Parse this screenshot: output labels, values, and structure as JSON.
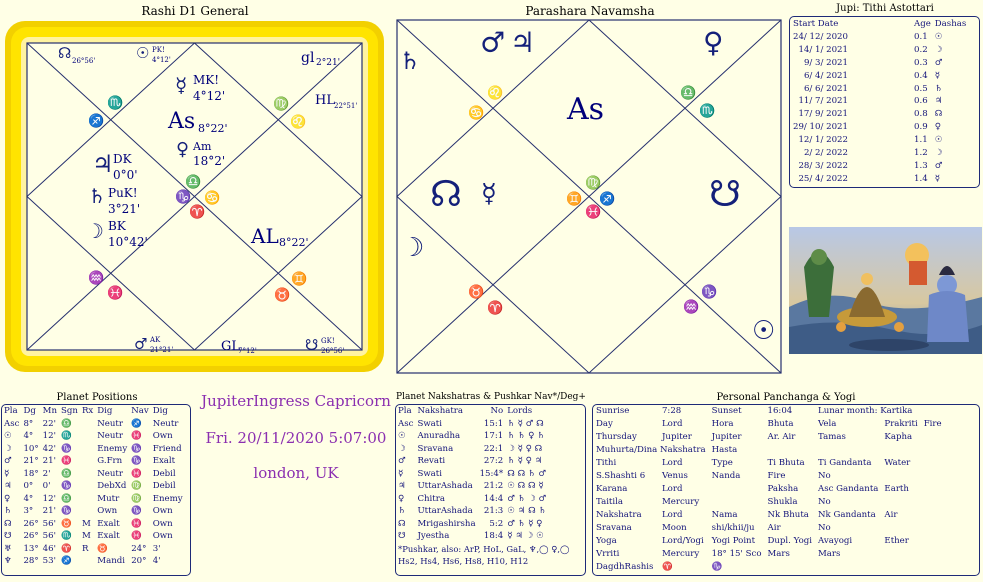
{
  "rashi": {
    "title": "Rashi D1 General",
    "signs": {
      "h1": "♎",
      "h2": "♏",
      "h3": "♐",
      "h4": "♑",
      "h5": "♒",
      "h6": "♓",
      "h7": "♈",
      "h8": "♉",
      "h9": "♊",
      "h10": "♋",
      "h11": "♌",
      "h12": "♍"
    },
    "asc_label": "As",
    "asc_deg": "8°22'",
    "mercury_tag": "MK!",
    "mercury_deg": "4°12'",
    "venus_tag": "Am",
    "venus_deg": "18°2'",
    "jupiter_tag": "DK",
    "jupiter_deg": "0°0'",
    "saturn_tag": "PuK!",
    "saturn_deg": "3°21'",
    "moon_tag": "BK",
    "moon_deg": "10°42'",
    "mars_tag": "AK",
    "mars_deg": "21°21'",
    "ketu_tag": "GK!",
    "ketu_deg": "26°56'",
    "rahu_deg": "26°56'",
    "sun_tag": "PK!",
    "sun_deg": "4°12'",
    "gl_top_label": "gl",
    "gl_top_deg": "2°21'",
    "hl_label": "HL",
    "hl_deg": "22°51'",
    "al_label": "AL",
    "al_deg": "8°22'",
    "gl_bottom_label": "GL",
    "gl_bottom_deg": "7°12'"
  },
  "navamsa": {
    "title": "Parashara Navamsha",
    "asc_label": "As",
    "signs": {
      "h1": "♍",
      "h2": "♌",
      "h3": "♋",
      "h4": "♊",
      "h5": "♉",
      "h6": "♈",
      "h7": "♓",
      "h8": "♒",
      "h9": "♑",
      "h10": "♐",
      "h11": "♏",
      "h12": "♎"
    }
  },
  "center": {
    "event": "JupiterIngress Capricorn",
    "date": "Fri. 20/11/2020  5:07:00",
    "place": "london, UK"
  },
  "tithi": {
    "title": "Jupi: Tithi Astottari",
    "headers": [
      "Start Date",
      "Age",
      "Dashas"
    ],
    "rows": [
      [
        "24/ 12/ 2020",
        "0.1",
        "☉"
      ],
      [
        "14/ 1/ 2021",
        "0.2",
        "☽"
      ],
      [
        "9/ 3/ 2021",
        "0.3",
        "♂"
      ],
      [
        "6/ 4/ 2021",
        "0.4",
        "☿"
      ],
      [
        "6/ 6/ 2021",
        "0.5",
        "♄"
      ],
      [
        "11/ 7/ 2021",
        "0.6",
        "♃"
      ],
      [
        "17/ 9/ 2021",
        "0.8",
        "☊"
      ],
      [
        "29/ 10/ 2021",
        "0.9",
        "♀"
      ],
      [
        "12/ 1/ 2022",
        "1.1",
        "☉"
      ],
      [
        "2/ 2/ 2022",
        "1.2",
        "☽"
      ],
      [
        "28/ 3/ 2022",
        "1.3",
        "♂"
      ],
      [
        "25/ 4/ 2022",
        "1.4",
        "☿"
      ]
    ]
  },
  "planets": {
    "title": "Planet Positions",
    "headers": [
      "Pla",
      "Dg",
      "Mn",
      "Sgn",
      "Rx",
      "Dig",
      "Nav",
      "Dig"
    ],
    "rows": [
      [
        "Asc",
        "8°",
        "22'",
        "♎",
        "",
        "Neutr",
        "♐",
        "Neutr"
      ],
      [
        "☉",
        "4°",
        "12'",
        "♏",
        "",
        "Neutr",
        "♓",
        "Own"
      ],
      [
        "☽",
        "10°",
        "42'",
        "♑",
        "",
        "Enemy",
        "♑",
        "Friend"
      ],
      [
        "♂",
        "21°",
        "21'",
        "♓",
        "",
        "G.Frn",
        "♑",
        "Exalt"
      ],
      [
        "☿",
        "18°",
        "2'",
        "♎",
        "",
        "Neutr",
        "♓",
        "Debil"
      ],
      [
        "♃",
        "0°",
        "0'",
        "♑",
        "",
        "DebXd",
        "♍",
        "Debil"
      ],
      [
        "♀",
        "4°",
        "12'",
        "♎",
        "",
        "Mutr",
        "♍",
        "Enemy"
      ],
      [
        "♄",
        "3°",
        "21'",
        "♑",
        "",
        "Own",
        "♑",
        "Own"
      ],
      [
        "☊",
        "26°",
        "56'",
        "♉",
        "M",
        "Exalt",
        "♓",
        "Own"
      ],
      [
        "☋",
        "26°",
        "56'",
        "♏",
        "M",
        "Exalt",
        "♓",
        "Own"
      ],
      [
        "♅",
        "13°",
        "46'",
        "♈",
        "R",
        "♉",
        "24°",
        "3'"
      ],
      [
        "♆",
        "28°",
        "53'",
        "♐",
        "",
        "Mandi",
        "20°",
        "4'"
      ]
    ],
    "last_row_tail": [
      "♏",
      "♍"
    ]
  },
  "nakshatras": {
    "title": "Planet Nakshatras & Pushkar Nav*/Deg+",
    "headers": [
      "Pla",
      "Nakshatra",
      "No",
      "Lords"
    ],
    "rows": [
      [
        "Asc",
        "Swati",
        "15:1",
        "♄ ☿ ♂ ☊"
      ],
      [
        "☉",
        "Anuradha",
        "17:1",
        "♄ ♄ ♀ ♄"
      ],
      [
        "☽",
        "Sravana",
        "22:1",
        "☽ ☿ ♀ ☊"
      ],
      [
        "♂",
        "Revati",
        "27:2",
        "♄ ☿ ♀ ♃"
      ],
      [
        "☿",
        "Swati",
        "15:4*",
        "☊ ☊ ♄ ♂"
      ],
      [
        "♃",
        "UttarAshada",
        "21:2",
        "☉ ☊ ☊ ☿"
      ],
      [
        "♀",
        "Chitra",
        "14:4",
        "♂ ♄ ☽ ♂"
      ],
      [
        "♄",
        "UttarAshada",
        "21:3",
        "☉ ♃ ☊ ♄"
      ],
      [
        "☊",
        "Mrigashirsha",
        "5:2",
        "♂ ♄ ☿ ♀"
      ],
      [
        "☋",
        "Jyestha",
        "18:4",
        "☿ ♃ ☽ ☉"
      ]
    ],
    "foot1": "*Pushkar, also:  ArP, HoL, GaL, ♆,◯ ♀,◯",
    "foot2": "Hs2, Hs4, Hs6, Hs8, H10, H12"
  },
  "panchanga": {
    "title": "Personal Panchanga & Yogi",
    "rows": [
      [
        "Sunrise",
        "7:28",
        "Sunset",
        "16:04",
        "Lunar month: Kartika",
        "",
        ""
      ],
      [
        "Day",
        "Lord",
        "Hora",
        "Bhuta",
        "Vela",
        "Prakriti",
        "Fire"
      ],
      [
        "Thursday",
        "Jupiter",
        "Jupiter",
        "Ar. Air",
        "Tamas",
        "Kapha",
        ""
      ],
      [
        "Muhurta/Dina Nakshatra",
        "",
        "Hasta",
        "",
        "",
        "",
        ""
      ],
      [
        "Tithi",
        "Lord",
        "Type",
        "Ti Bhuta",
        "Ti Gandanta",
        "Water",
        ""
      ],
      [
        "S.Shashti 6",
        "Venus",
        "Nanda",
        "Fire",
        "No",
        "",
        ""
      ],
      [
        "Karana",
        "Lord",
        "",
        "Paksha",
        "Asc Gandanta",
        "Earth",
        ""
      ],
      [
        "Taitila",
        "Mercury",
        "",
        "Shukla",
        "No",
        "",
        ""
      ],
      [
        "Nakshatra",
        "Lord",
        "Nama",
        "Nk Bhuta",
        "Nk Gandanta",
        "Air",
        ""
      ],
      [
        "Sravana",
        "Moon",
        "shi/khii/ju",
        "Air",
        "No",
        "",
        ""
      ],
      [
        "Yoga",
        "Lord/Yogi",
        "Yogi Point",
        "Dupl. Yogi",
        "Avayogi",
        "Ether",
        ""
      ],
      [
        "Vrriti",
        "Mercury",
        "18° 15' Sco",
        "Mars",
        "Mars",
        "",
        ""
      ],
      [
        "DagdhRashis",
        "♈",
        "♑",
        "",
        "",
        "",
        ""
      ]
    ]
  },
  "image": {
    "alt": "Shiva deity painting",
    "icon": "deity-image"
  }
}
